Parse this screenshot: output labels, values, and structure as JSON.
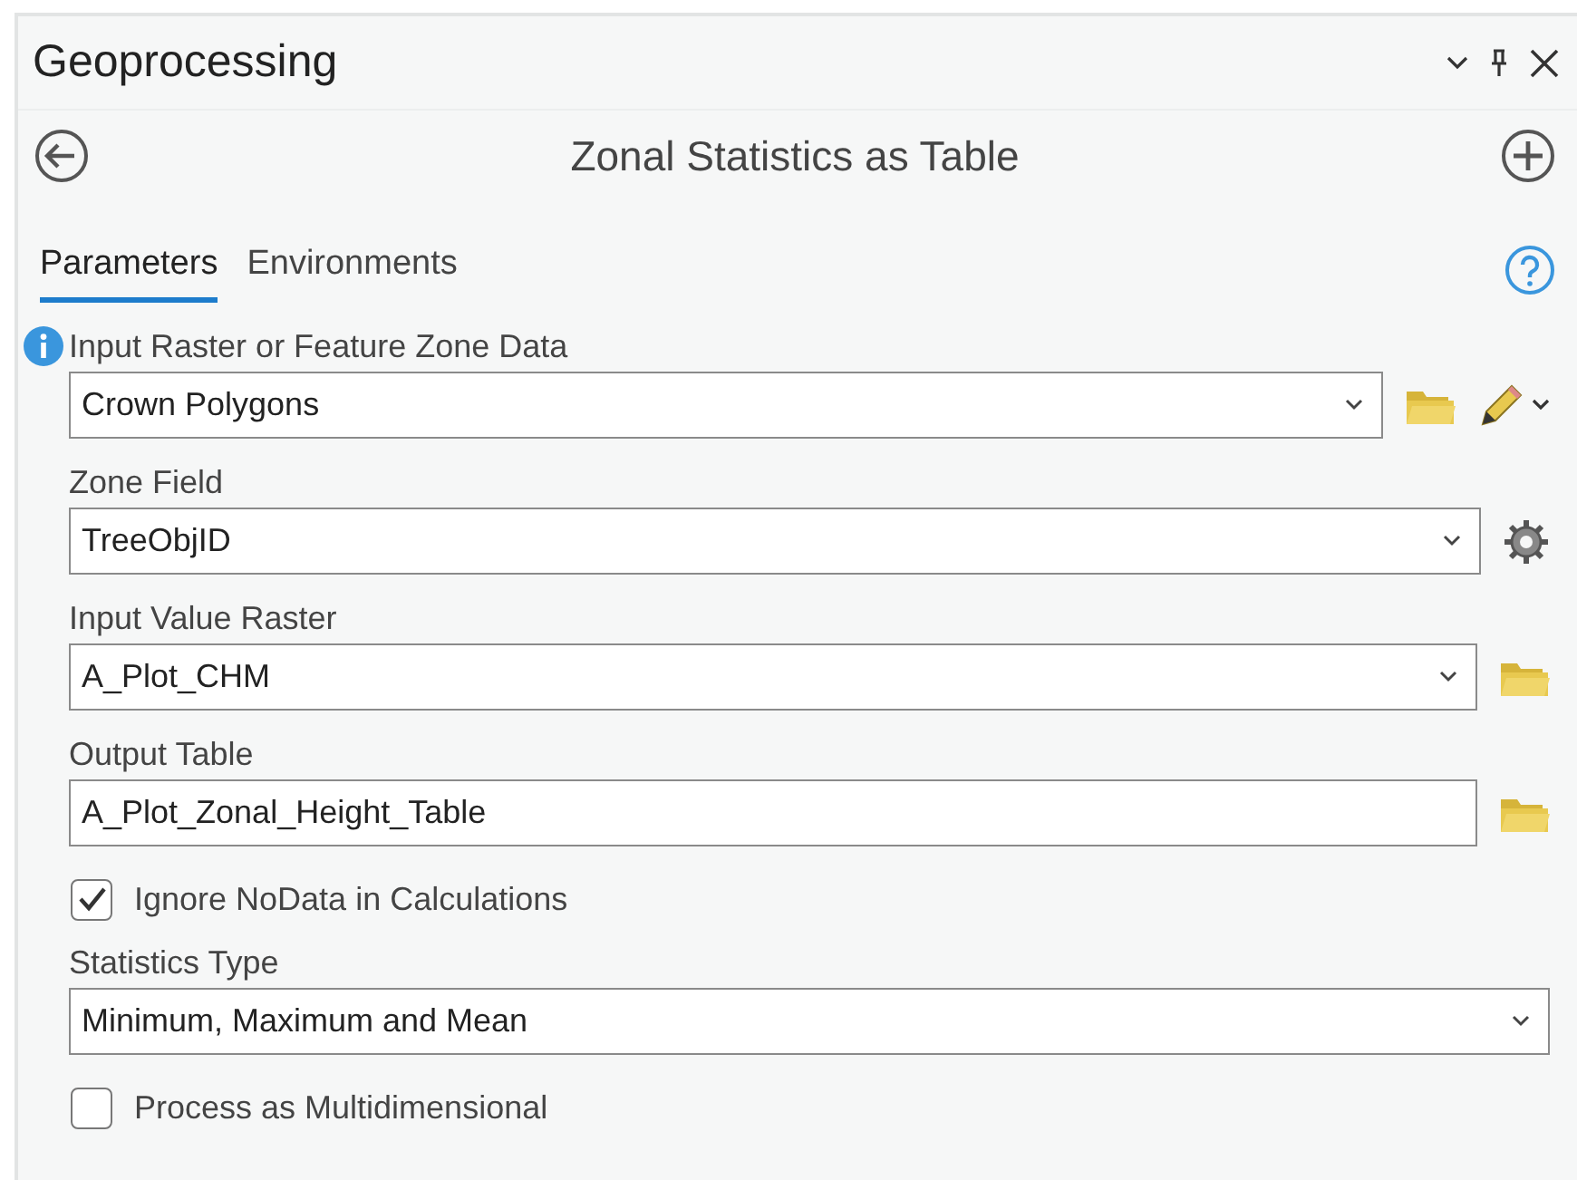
{
  "pane": {
    "title": "Geoprocessing"
  },
  "tool": {
    "title": "Zonal Statistics as Table"
  },
  "tabs": [
    {
      "label": "Parameters",
      "selected": true
    },
    {
      "label": "Environments",
      "selected": false
    }
  ],
  "parameters": [
    {
      "kind": "dropdown",
      "label": "Input Raster or Feature Zone Data",
      "value": "Crown Polygons",
      "info": true,
      "actions": [
        {
          "kind": "folder"
        },
        {
          "kind": "pencil"
        }
      ]
    },
    {
      "kind": "dropdown",
      "label": "Zone Field",
      "value": "TreeObjID",
      "info": false,
      "actions": [
        {
          "kind": "gear"
        }
      ]
    },
    {
      "kind": "dropdown",
      "label": "Input Value Raster",
      "value": "A_Plot_CHM",
      "info": false,
      "actions": [
        {
          "kind": "folder"
        }
      ]
    },
    {
      "kind": "text",
      "label": "Output Table",
      "value": "A_Plot_Zonal_Height_Table",
      "info": false,
      "actions": [
        {
          "kind": "folder"
        }
      ]
    },
    {
      "kind": "checkbox",
      "label": "Ignore NoData in Calculations",
      "checked": true
    },
    {
      "kind": "dropdown",
      "label": "Statistics Type",
      "value": "Minimum, Maximum and Mean",
      "info": false
    },
    {
      "kind": "checkbox",
      "label": "Process as Multidimensional",
      "checked": false
    }
  ]
}
